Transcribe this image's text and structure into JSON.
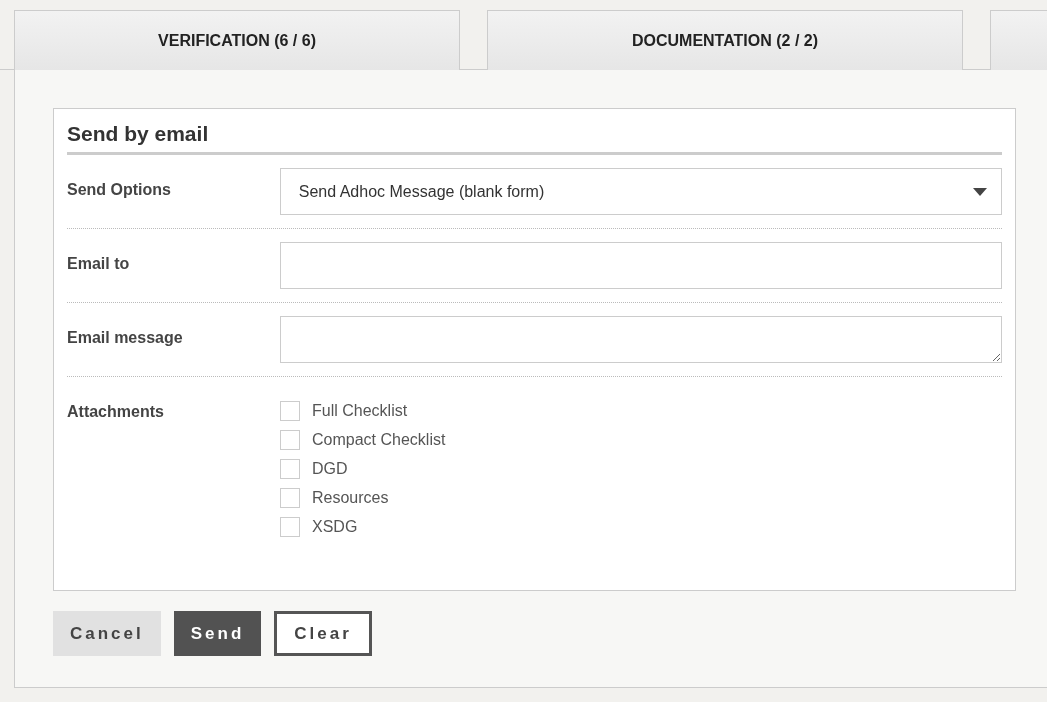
{
  "tabs": [
    {
      "label": "VERIFICATION (6 / 6)"
    },
    {
      "label": "DOCUMENTATION (2 / 2)"
    }
  ],
  "form": {
    "title": "Send by email",
    "send_options": {
      "label": "Send Options",
      "value": "Send Adhoc Message (blank form)"
    },
    "email_to": {
      "label": "Email to"
    },
    "email_message": {
      "label": "Email message"
    },
    "attachments": {
      "label": "Attachments",
      "items": [
        {
          "label": "Full Checklist",
          "checked": false
        },
        {
          "label": "Compact Checklist",
          "checked": false
        },
        {
          "label": "DGD",
          "checked": false
        },
        {
          "label": "Resources",
          "checked": false
        },
        {
          "label": "XSDG",
          "checked": false
        }
      ]
    }
  },
  "buttons": [
    {
      "label": "Cancel",
      "kind": "secondary"
    },
    {
      "label": "Send",
      "kind": "primary"
    },
    {
      "label": "Clear",
      "kind": "outline"
    }
  ]
}
